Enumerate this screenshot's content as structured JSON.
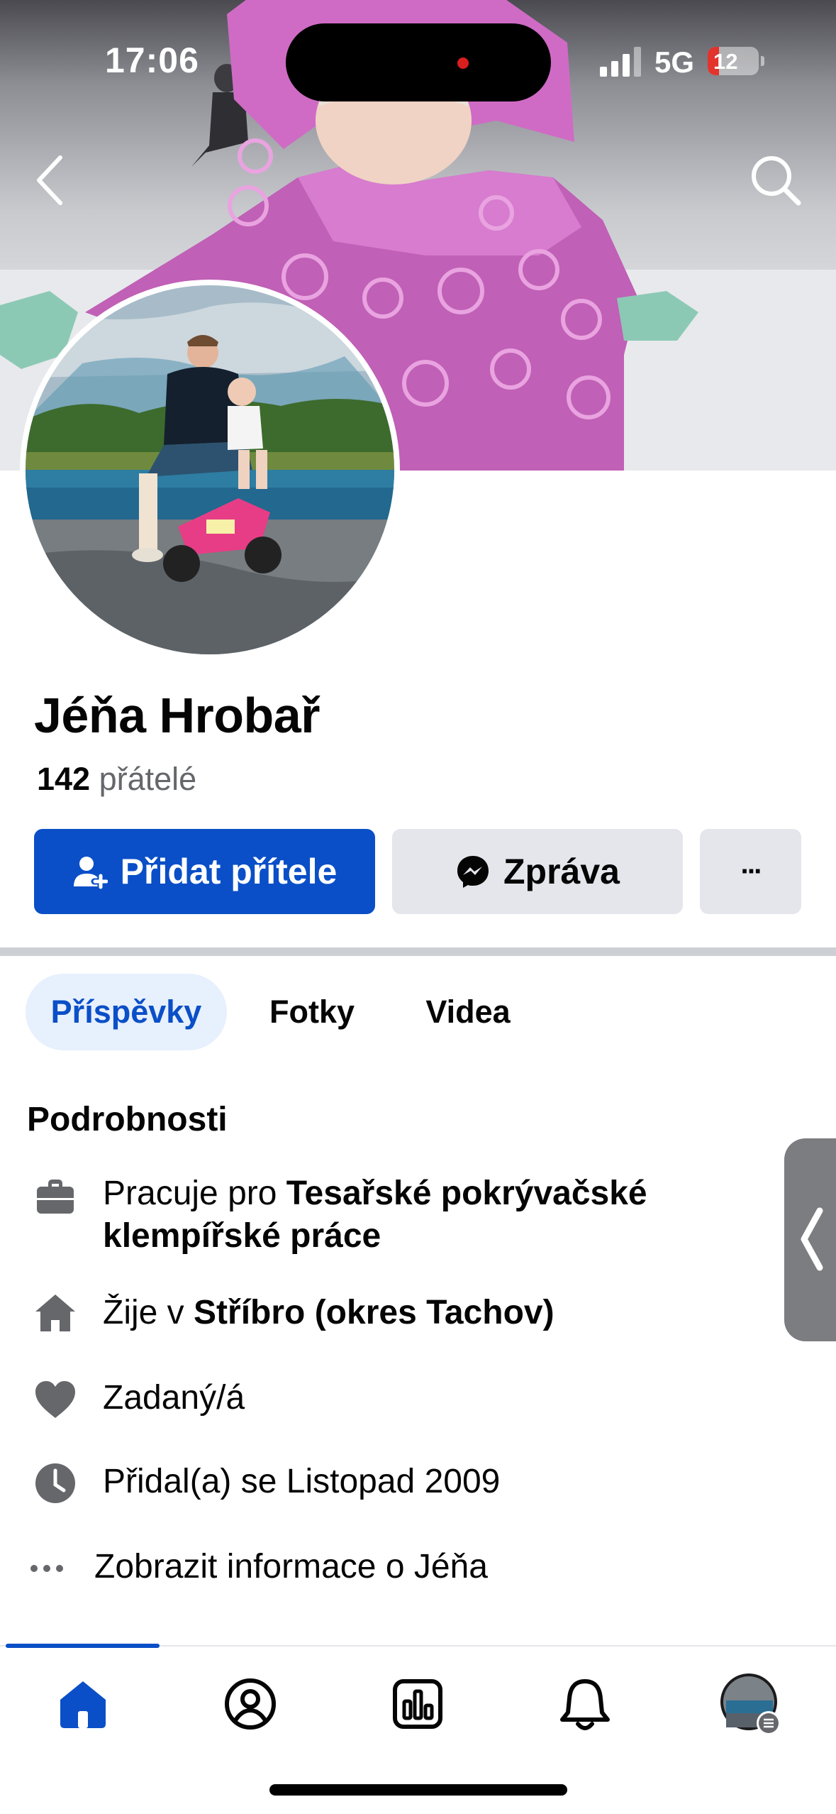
{
  "status_bar": {
    "time": "17:06",
    "network": "5G",
    "battery_level": "12",
    "battery_icon": "battery-charging-icon"
  },
  "header": {
    "back_icon": "chevron-left-icon",
    "search_icon": "search-icon"
  },
  "profile": {
    "name": "Jéňa Hrobař",
    "friends_count": "142",
    "friends_label": "přátelé"
  },
  "actions": {
    "add_friend": "Přidat přítele",
    "message": "Zpráva",
    "more": "···"
  },
  "tabs": [
    {
      "label": "Příspěvky",
      "active": true
    },
    {
      "label": "Fotky",
      "active": false
    },
    {
      "label": "Videa",
      "active": false
    }
  ],
  "details": {
    "title": "Podrobnosti",
    "work_prefix": "Pracuje pro ",
    "work_line1": "Tesařské pokrývačské",
    "work_line2": "klempířské práce",
    "lives_prefix": "Žije v ",
    "lives_place": "Stříbro (okres Tachov)",
    "relationship": "Zadaný/á",
    "joined": "Přidal(a) se Listopad 2009",
    "more_info": "Zobrazit informace o Jéňa"
  },
  "bottom_nav": [
    {
      "icon": "home-icon",
      "active": true
    },
    {
      "icon": "profile-icon",
      "active": false
    },
    {
      "icon": "dashboard-icon",
      "active": false
    },
    {
      "icon": "bell-icon",
      "active": false
    },
    {
      "icon": "account-avatar",
      "active": false
    }
  ],
  "colors": {
    "accent": "#0a4fc7",
    "tab_active_bg": "#e7f0fd",
    "secondary_button": "#e4e6eb",
    "text_muted": "#65676b"
  }
}
